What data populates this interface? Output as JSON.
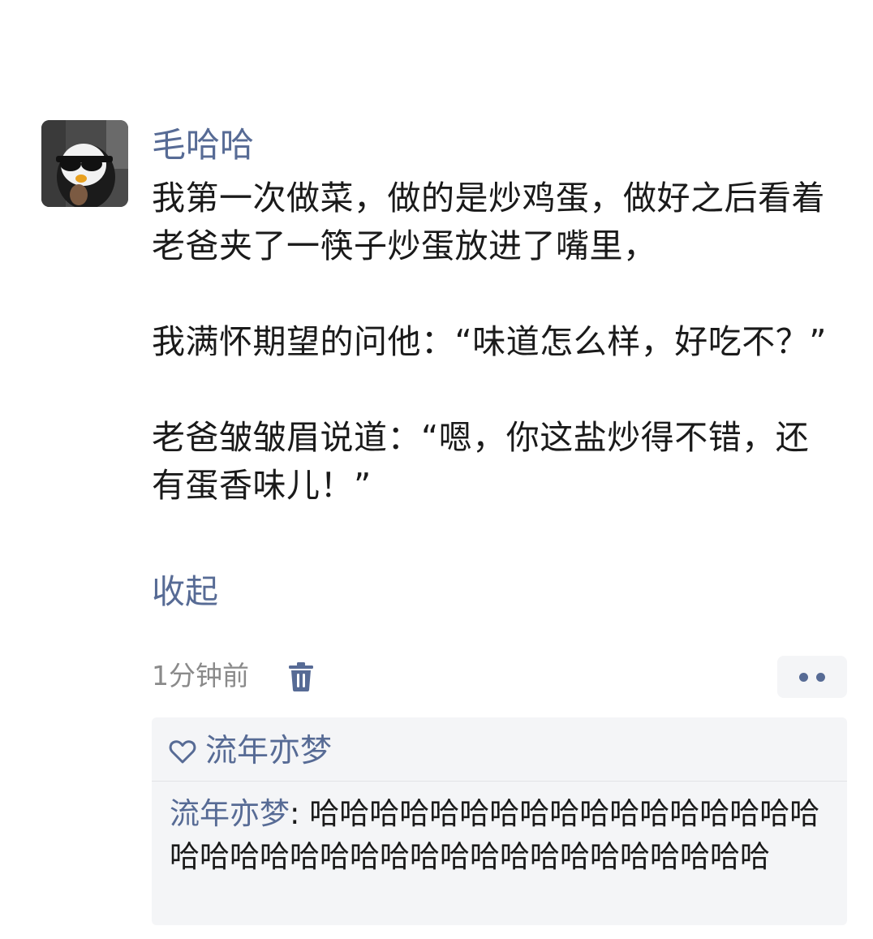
{
  "post": {
    "author": "毛哈哈",
    "paragraphs": [
      "我第一次做菜，做的是炒鸡蛋，做好之后看着老爸夹了一筷子炒蛋放进了嘴里，",
      "我满怀期望的问他：“味道怎么样，好吃不？”",
      "老爸皱皱眉说道：“嗯，你这盐炒得不错，还有蛋香味儿！”"
    ],
    "collapse_label": "收起",
    "timestamp": "1分钟前"
  },
  "icons": {
    "avatar": "penguin-with-sunglasses-avatar",
    "delete": "trash-icon",
    "more": "more-dots-icon",
    "like": "heart-outline-icon"
  },
  "interactions": {
    "likes": [
      "流年亦梦"
    ],
    "comments": [
      {
        "author": "流年亦梦",
        "separator": ": ",
        "text": "哈哈哈哈哈哈哈哈哈哈哈哈哈哈哈哈哈哈哈哈哈哈哈哈哈哈哈哈哈哈哈哈哈哈哈哈哈"
      }
    ]
  },
  "colors": {
    "link": "#576b95",
    "text": "#1a1a1a",
    "meta": "#8a8a8a",
    "panel": "#f4f5f7"
  }
}
